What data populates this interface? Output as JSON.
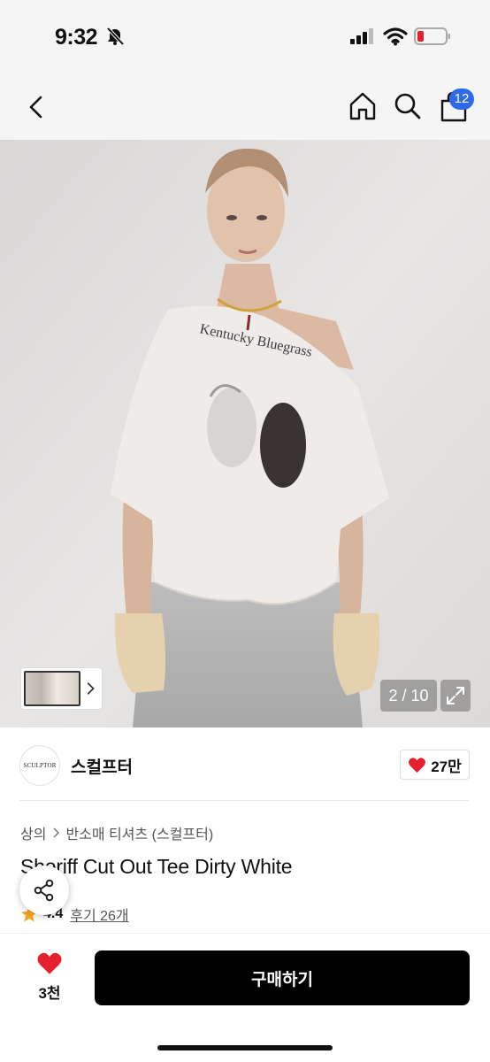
{
  "status_bar": {
    "time": "9:32"
  },
  "nav": {
    "cart_count": "12"
  },
  "gallery": {
    "print_text": "Kentucky Bluegrass",
    "page_counter": "2 / 10"
  },
  "brand": {
    "logo_text": "SCULPTOR",
    "name": "스컬프터",
    "like_count": "27만"
  },
  "breadcrumb": [
    "상의",
    "반소매 티셔츠 (스컬프터)"
  ],
  "product": {
    "title": "Sheriff Cut Out Tee Dirty White",
    "rating": "4.4",
    "review_link": "후기 26개"
  },
  "bottom_bar": {
    "like_count": "3천",
    "buy_label": "구매하기"
  },
  "colors": {
    "accent_blue": "#2f6ae8",
    "heart_red": "#e5212f",
    "star_orange": "#f5a623",
    "buy_black": "#000000"
  }
}
